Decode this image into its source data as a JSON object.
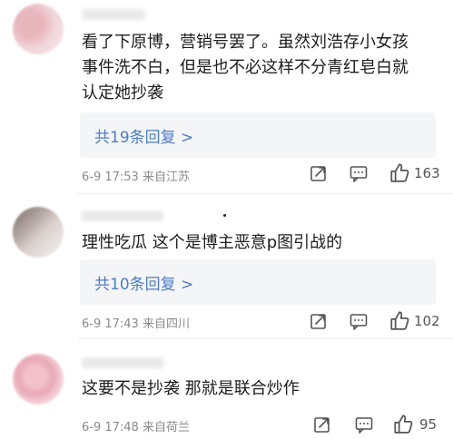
{
  "comments": [
    {
      "text_lines": [
        "看了下原博，营销号罢了。虽然刘浩存小女孩",
        "事件洗不白，但是也不必这样不分青红皂白就",
        "认定她抄袭"
      ],
      "replies": "共19条回复 >",
      "meta": "6-9 17:53 来自江苏",
      "likes": "163"
    },
    {
      "text_lines": [
        "理性吃瓜 这个是博主恶意p图引战的"
      ],
      "replies": "共10条回复 >",
      "meta": "6-9 17:43 来自四川",
      "likes": "102"
    },
    {
      "text_lines": [
        "这要不是抄袭 那就是联合炒作"
      ],
      "meta": "6-9 17:48 来自荷兰",
      "likes": "95"
    }
  ],
  "icons": {
    "share": "share-icon",
    "comment": "comment-icon",
    "like": "thumbs-up-icon"
  },
  "colors": {
    "reply_link": "#4e7cc6",
    "reply_bg": "#f4f5f7",
    "meta_text": "#8a8a8a"
  }
}
